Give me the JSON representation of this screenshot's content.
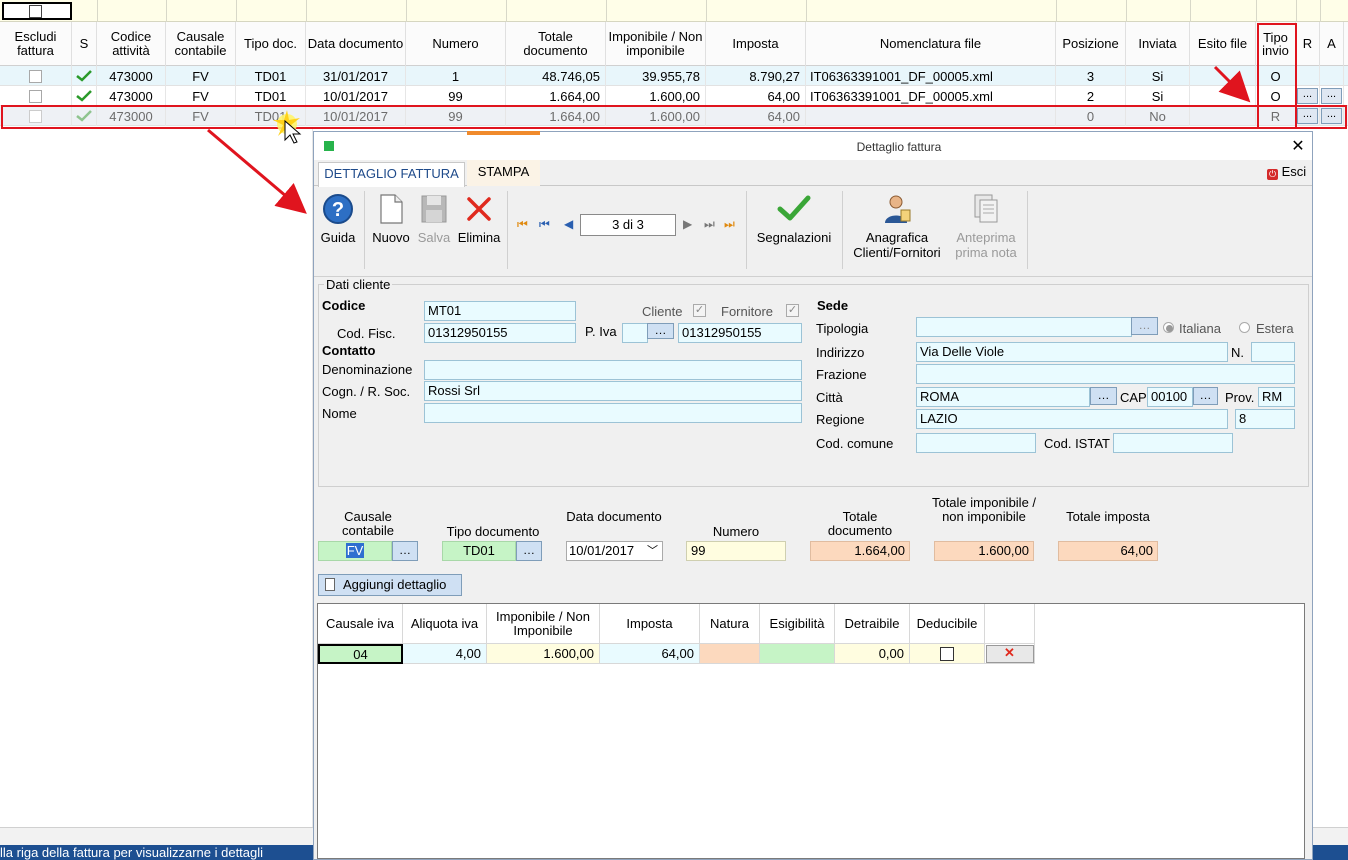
{
  "grid": {
    "headers": [
      "Escludi fattura",
      "S",
      "Codice attività",
      "Causale contabile",
      "Tipo doc.",
      "Data documento",
      "Numero",
      "Totale documento",
      "Imponibile / Non imponibile",
      "Imposta",
      "Nomenclatura file",
      "Posizione",
      "Inviata",
      "Esito file",
      "Tipo invio",
      "R",
      "A"
    ],
    "rows": [
      {
        "codice": "473000",
        "causale": "FV",
        "tipo": "TD01",
        "data": "31/01/2017",
        "numero": "1",
        "totale": "48.746,05",
        "imponibile": "39.955,78",
        "imposta": "8.790,27",
        "file": "IT06363391001_DF_00005.xml",
        "posizione": "3",
        "inviata": "Si",
        "esito": "",
        "tipo_invio": "O",
        "r": "",
        "a": ""
      },
      {
        "codice": "473000",
        "causale": "FV",
        "tipo": "TD01",
        "data": "10/01/2017",
        "numero": "99",
        "totale": "1.664,00",
        "imponibile": "1.600,00",
        "imposta": "64,00",
        "file": "IT06363391001_DF_00005.xml",
        "posizione": "2",
        "inviata": "Si",
        "esito": "",
        "tipo_invio": "O",
        "r": "...",
        "a": "..."
      },
      {
        "codice": "473000",
        "causale": "FV",
        "tipo": "TD01",
        "data": "10/01/2017",
        "numero": "99",
        "totale": "1.664,00",
        "imponibile": "1.600,00",
        "imposta": "64,00",
        "file": "",
        "posizione": "0",
        "inviata": "No",
        "esito": "",
        "tipo_invio": "R",
        "r": "...",
        "a": "..."
      }
    ]
  },
  "statusbar": {
    "text": "lla riga della fattura per visualizzarne i dettagli"
  },
  "dialog": {
    "title": "Dettaglio fattura",
    "close": "✕",
    "tabs": [
      "DETTAGLIO FATTURA",
      "STAMPA"
    ],
    "esci": "Esci",
    "toolbar": {
      "guida": "Guida",
      "nuovo": "Nuovo",
      "salva": "Salva",
      "elimina": "Elimina",
      "nav_value": "3 di 3",
      "segnalazioni": "Segnalazioni",
      "anagrafica": "Anagrafica Clienti/Fornitori",
      "anteprima": "Anteprima prima nota"
    },
    "cliente": {
      "group": "Dati cliente",
      "codice_label": "Codice",
      "codice": "MT01",
      "cliente_label": "Cliente",
      "fornitore_label": "Fornitore",
      "codfisc_label": "Cod. Fisc.",
      "codfisc": "01312950155",
      "piva_label": "P. Iva",
      "piva_prefix": "",
      "piva": "01312950155",
      "contatto": "Contatto",
      "denominazione_label": "Denominazione",
      "denominazione": "",
      "cognome_label": "Cogn. / R. Soc.",
      "cognome": "Rossi Srl",
      "nome_label": "Nome",
      "nome": ""
    },
    "sede": {
      "title": "Sede",
      "tipologia_label": "Tipologia",
      "tipologia": "",
      "italiana": "Italiana",
      "estera": "Estera",
      "indirizzo_label": "Indirizzo",
      "indirizzo": "Via Delle Viole",
      "n_label": "N.",
      "n": "",
      "frazione_label": "Frazione",
      "frazione": "",
      "citta_label": "Città",
      "citta": "ROMA",
      "cap_label": "CAP",
      "cap": "00100",
      "prov_label": "Prov.",
      "prov": "RM",
      "regione_label": "Regione",
      "regione": "LAZIO",
      "regione_code": "8",
      "codcomune_label": "Cod. comune",
      "codcomune": "",
      "codistat_label": "Cod. ISTAT",
      "codistat": ""
    },
    "doc": {
      "causale_label": "Causale contabile",
      "causale": "FV",
      "tipo_label": "Tipo documento",
      "tipo": "TD01",
      "data_label": "Data documento",
      "data": "10/01/2017",
      "numero_label": "Numero",
      "numero": "99",
      "totale_label": "Totale documento",
      "totale": "1.664,00",
      "imponibile_label": "Totale imponibile / non imponibile",
      "imponibile": "1.600,00",
      "imposta_label": "Totale imposta",
      "imposta": "64,00"
    },
    "aggiungi": "Aggiungi dettaglio",
    "detail": {
      "headers": [
        "Causale iva",
        "Aliquota iva",
        "Imponibile / Non Imponibile",
        "Imposta",
        "Natura",
        "Esigibilità",
        "Detraibile",
        "Deducibile"
      ],
      "row": {
        "causale": "04",
        "aliquota": "4,00",
        "imponibile": "1.600,00",
        "imposta": "64,00",
        "natura": "",
        "esigibilita": "",
        "detraibile": "0,00"
      }
    }
  },
  "colors": {
    "highlight": "#e0141e",
    "row_selected": "#e8f6fb",
    "peach": "#fcd9be",
    "green": "#c6f4c6",
    "yellow": "#fffde0"
  }
}
